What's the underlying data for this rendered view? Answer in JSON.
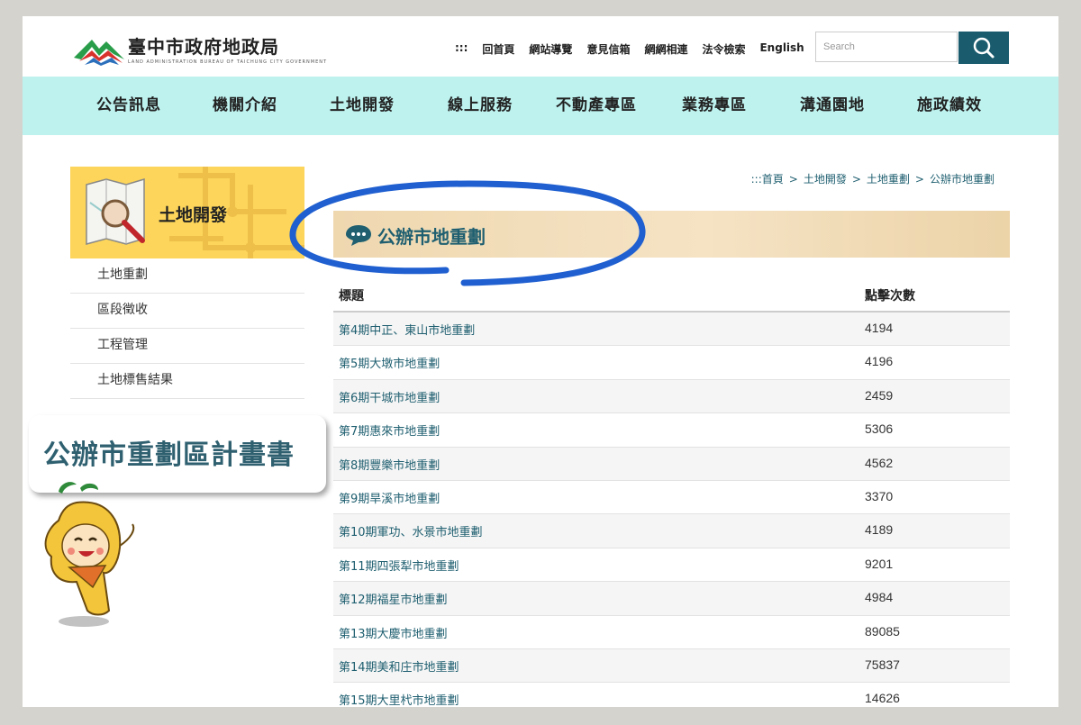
{
  "header": {
    "logo_text": "臺中市政府地政局",
    "logo_subtext": "LAND ADMINISTRATION BUREAU OF TAICHUNG CITY GOVERNMENT",
    "toplinks": [
      ":::",
      "回首頁",
      "網站導覽",
      "意見信箱",
      "網網相連",
      "法令檢索",
      "English"
    ],
    "search_placeholder": "Search"
  },
  "nav": [
    "公告訊息",
    "機關介紹",
    "土地開發",
    "線上服務",
    "不動產專區",
    "業務專區",
    "溝通園地",
    "施政績效"
  ],
  "sidebar": {
    "title": "土地開發",
    "items": [
      "土地重劃",
      "區段徵收",
      "工程管理",
      "土地標售結果"
    ]
  },
  "callout": "公辦市重劃區計畫書",
  "breadcrumb": [
    ":::首頁",
    ">",
    "土地開發",
    ">",
    "土地重劃",
    ">",
    "公辦市地重劃"
  ],
  "page_title": "公辦市地重劃",
  "table": {
    "headers": [
      "標題",
      "點擊次數"
    ],
    "rows": [
      [
        "第4期中正、東山市地重劃",
        "4194"
      ],
      [
        "第5期大墩市地重劃",
        "4196"
      ],
      [
        "第6期干城市地重劃",
        "2459"
      ],
      [
        "第7期惠來市地重劃",
        "5306"
      ],
      [
        "第8期豐樂市地重劃",
        "4562"
      ],
      [
        "第9期旱溪市地重劃",
        "3370"
      ],
      [
        "第10期軍功、水景市地重劃",
        "4189"
      ],
      [
        "第11期四張犁市地重劃",
        "9201"
      ],
      [
        "第12期福星市地重劃",
        "4984"
      ],
      [
        "第13期大慶市地重劃",
        "89085"
      ],
      [
        "第14期美和庄市地重劃",
        "75837"
      ],
      [
        "第15期大里杙市地重劃",
        "14626"
      ]
    ]
  },
  "colors": {
    "accent": "#1f5f70",
    "nav_bg": "#bdf2ef",
    "sidebar_banner": "#fcd55a",
    "annotation_oval": "#1f5fd0"
  }
}
